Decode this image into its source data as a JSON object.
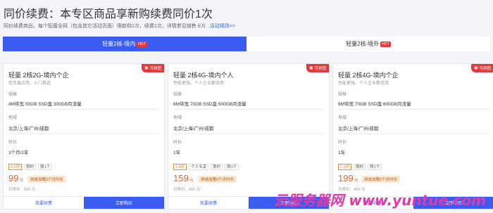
{
  "page": {
    "title": "同价续费：本专区商品享新购续费同价1次",
    "subtitle": "同价续费商品，每个配置全网（包含其它活动页面）限新购1次，续费1次，详情参见销售卡片",
    "rules_link": "活动规则>>"
  },
  "tabs": [
    {
      "label": "轻量2核-境内",
      "badge": "HOT",
      "active": true
    },
    {
      "label": "轻量2核-境外",
      "badge": "HOT",
      "active": false
    }
  ],
  "corner_badge": "可拼团",
  "cards": [
    {
      "name": "轻量 2核2G-境内个企",
      "desc": "低负载应用，入门首选",
      "spec_label": "规格",
      "spec": "4M带宽 50GB SSD盘 300GB月流量",
      "region_label": "地域",
      "region": "北京/上海/广州/成都",
      "duration_label": "时长",
      "duration": "3个月/1年",
      "tags": [
        "1.6折",
        "限时",
        "限1个"
      ],
      "price": "99",
      "price_unit": "元",
      "promo": "拼成加赠3个月时长",
      "original": "日常价：600 元",
      "renew_label": "我要续费",
      "buy_label": "立即购买"
    },
    {
      "name": "轻量 2核4G-境内个人",
      "desc": "性能更强，个人企业都适用",
      "spec_label": "规格",
      "spec": "6M带宽 70GB SSD盘 600GB月流量",
      "region_label": "地域",
      "region": "北京/上海/广州/成都",
      "duration_label": "时长",
      "duration": "1年",
      "tags": [
        "1.8折",
        "个人专享",
        "限时",
        "限1个"
      ],
      "price": "159",
      "price_unit": "元",
      "promo": "拼成加赠3个月时长",
      "original": "日常价：900 元",
      "renew_label": "我要续费",
      "buy_label": "立即购买"
    },
    {
      "name": "轻量 2核4G-境内个企",
      "desc": "性能更强，个人企业都适用",
      "spec_label": "规格",
      "spec": "6M带宽 70GB SSD盘 600GB月流量",
      "region_label": "地域",
      "region": "北京/上海/广州/成都",
      "duration_label": "时长",
      "duration": "1年",
      "tags": [
        "2.2折",
        "限时",
        "限1个"
      ],
      "price": "199",
      "price_unit": "元",
      "promo": "拼成加赠3个月时长",
      "original": "日常价：900 元",
      "renew_label": "我要续费",
      "buy_label": "立即购买"
    }
  ],
  "watermark": "云服务器网 www.yuntue.com",
  "colors": {
    "accent": "#3b5cf0",
    "hot": "#e4393c",
    "price": "#f25e2e",
    "link": "#2b6cf6"
  }
}
